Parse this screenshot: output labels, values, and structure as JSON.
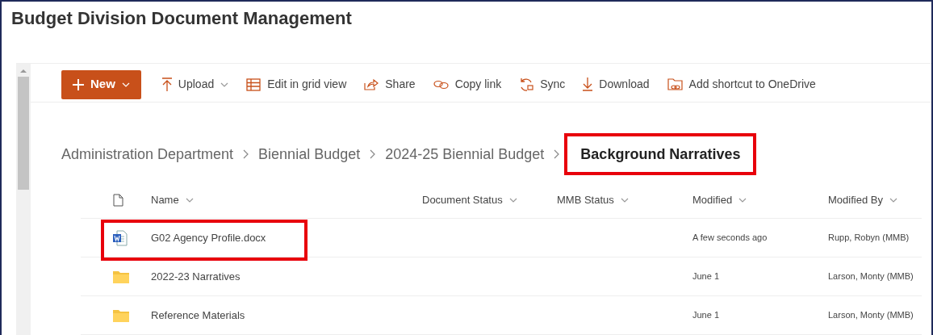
{
  "title": "Budget Division Document Management",
  "toolbar": [
    {
      "kind": "new",
      "label": "New",
      "dropdown": true
    },
    {
      "kind": "command",
      "label": "Upload",
      "dropdown": true
    },
    {
      "kind": "command",
      "label": "Edit in grid view",
      "dropdown": false
    },
    {
      "kind": "command",
      "label": "Share",
      "dropdown": false
    },
    {
      "kind": "command",
      "label": "Copy link",
      "dropdown": false
    },
    {
      "kind": "command",
      "label": "Sync",
      "dropdown": false
    },
    {
      "kind": "command",
      "label": "Download",
      "dropdown": false
    },
    {
      "kind": "command",
      "label": "Add shortcut to OneDrive",
      "dropdown": false
    }
  ],
  "breadcrumb": [
    {
      "label": "Administration Department",
      "current": false,
      "highlighted": false
    },
    {
      "label": "Biennial Budget",
      "current": false,
      "highlighted": false
    },
    {
      "label": "2024-25 Biennial Budget",
      "current": false,
      "highlighted": false
    },
    {
      "label": "Background Narratives",
      "current": true,
      "highlighted": true
    }
  ],
  "table": {
    "columns": [
      "Name",
      "Document Status",
      "MMB Status",
      "Modified",
      "Modified By"
    ],
    "rows": [
      {
        "kind": "word",
        "name": "G02 Agency Profile.docx",
        "modified": "A few seconds ago",
        "modified_by": "Rupp, Robyn (MMB)",
        "highlighted": true
      },
      {
        "kind": "folder",
        "name": "2022-23 Narratives",
        "modified": "June 1",
        "modified_by": "Larson, Monty (MMB)",
        "highlighted": false
      },
      {
        "kind": "folder",
        "name": "Reference Materials",
        "modified": "June 1",
        "modified_by": "Larson, Monty (MMB)",
        "highlighted": false
      }
    ]
  }
}
